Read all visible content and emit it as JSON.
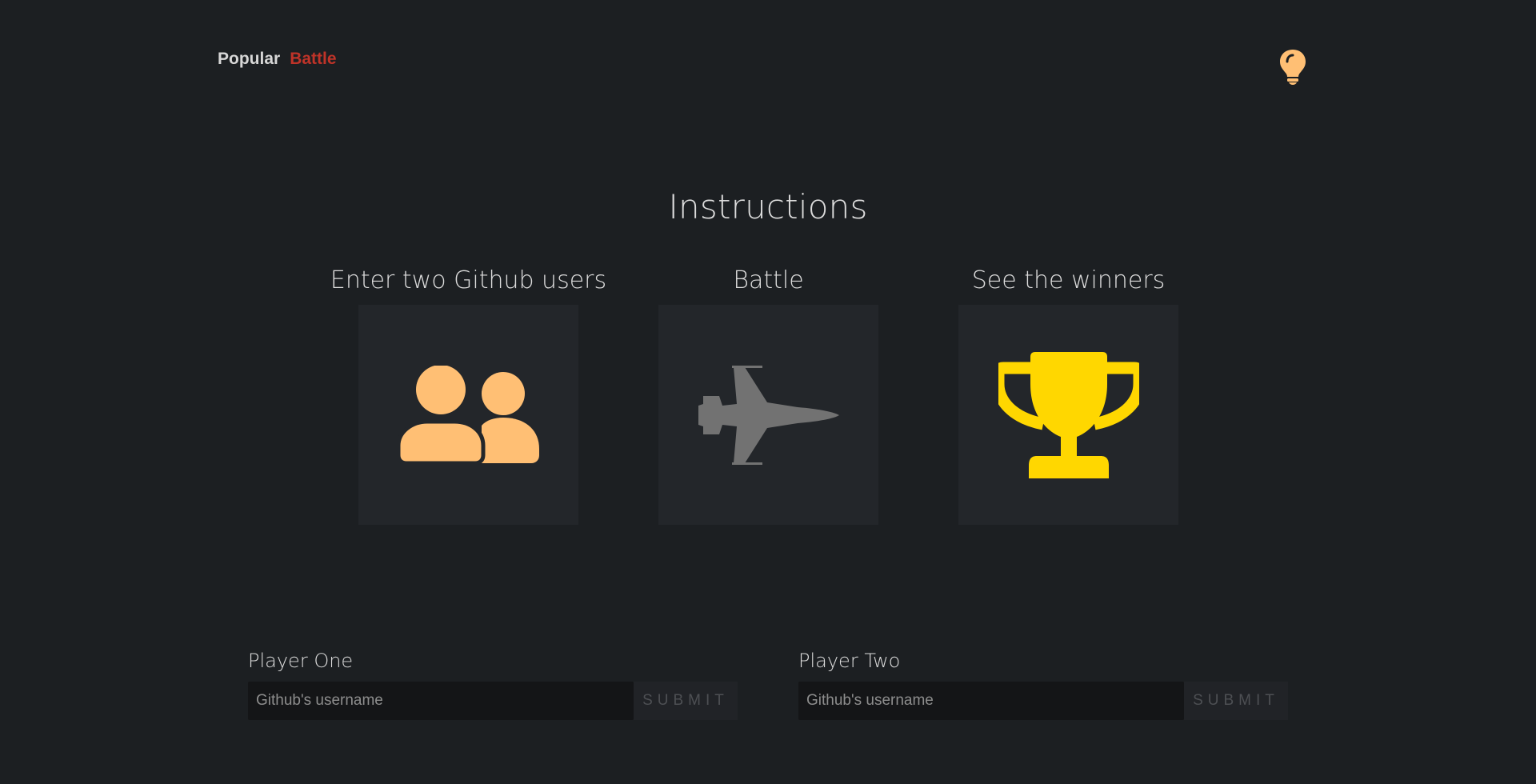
{
  "nav": {
    "links": [
      {
        "label": "Popular",
        "color": "#d7d7d7"
      },
      {
        "label": "Battle",
        "color": "#bf3328"
      }
    ],
    "theme_icon": "lightbulb-icon"
  },
  "instructions": {
    "title": "Instructions",
    "steps": [
      {
        "label": "Enter two Github users",
        "icon": "users-icon",
        "color": "#ffbf74"
      },
      {
        "label": "Battle",
        "icon": "fighter-jet-icon",
        "color": "#727272"
      },
      {
        "label": "See the winners",
        "icon": "trophy-icon",
        "color": "#ffd700"
      }
    ]
  },
  "players": [
    {
      "label": "Player One",
      "placeholder": "Github's username",
      "submit_label": "SUBMIT"
    },
    {
      "label": "Player Two",
      "placeholder": "Github's username",
      "submit_label": "SUBMIT"
    }
  ]
}
